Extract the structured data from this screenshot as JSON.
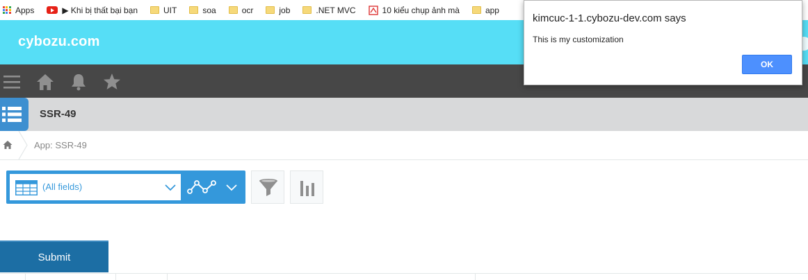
{
  "bookmarks": {
    "items": [
      {
        "label": "Apps",
        "icon": "apps-grid-icon"
      },
      {
        "label": "▶ Khi bị thất bại bạn",
        "icon": "youtube-icon"
      },
      {
        "label": "UIT",
        "icon": "folder-icon"
      },
      {
        "label": "soa",
        "icon": "folder-icon"
      },
      {
        "label": "ocr",
        "icon": "folder-icon"
      },
      {
        "label": "job",
        "icon": "folder-icon"
      },
      {
        "label": ".NET MVC",
        "icon": "folder-icon"
      },
      {
        "label": "10 kiểu chụp ảnh mà",
        "icon": "site-icon"
      },
      {
        "label": "app",
        "icon": "folder-icon"
      }
    ]
  },
  "header": {
    "logo": "cybozu.com"
  },
  "navbar": {
    "icons": [
      "menu-icon",
      "home-icon",
      "bell-icon",
      "star-icon"
    ]
  },
  "app": {
    "title": "SSR-49"
  },
  "breadcrumb": {
    "text": "App: SSR-49"
  },
  "toolbar": {
    "view_select": "(All fields)"
  },
  "submit": {
    "label": "Submit"
  },
  "dialog": {
    "title": "kimcuc-1-1.cybozu-dev.com says",
    "message": "This is my customization",
    "ok_label": "OK"
  },
  "colors": {
    "header": "#56def6",
    "navbar": "#474747",
    "accent": "#3498db",
    "submit": "#1c6ea4",
    "ok": "#4d90fe"
  }
}
